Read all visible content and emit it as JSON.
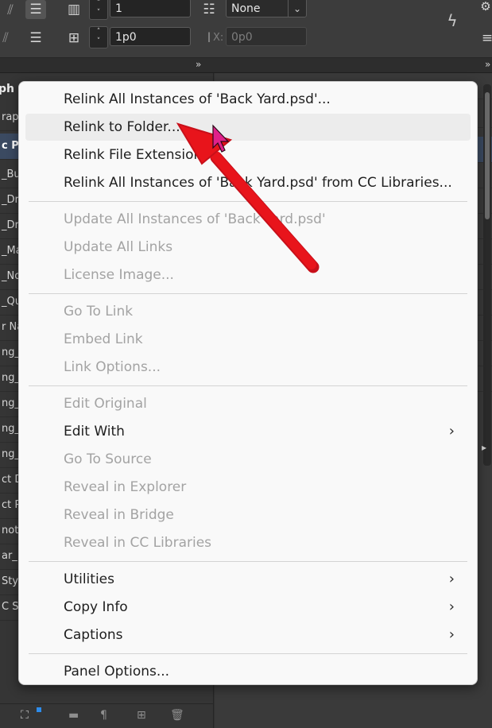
{
  "toolbar": {
    "row1": {
      "columns_value": "1",
      "align_value": "None"
    },
    "row2": {
      "gutter_value": "1p0",
      "indent_label": "X:",
      "indent_value": "0p0"
    }
  },
  "left_panel": {
    "title": "ph S",
    "items": [
      {
        "label": "raph"
      },
      {
        "label": "c P"
      },
      {
        "label": "_Bul"
      },
      {
        "label": "_Dro"
      },
      {
        "label": "_Dro"
      },
      {
        "label": "_Ma"
      },
      {
        "label": "_No"
      },
      {
        "label": "_Que"
      },
      {
        "label": "r Na"
      },
      {
        "label": "ng_"
      },
      {
        "label": "ng_"
      },
      {
        "label": "ng_"
      },
      {
        "label": "ng_"
      },
      {
        "label": "ng_"
      },
      {
        "label": "ct D"
      },
      {
        "label": "ct P"
      },
      {
        "label": "note"
      },
      {
        "label": "ar_E"
      },
      {
        "label": "Sty"
      },
      {
        "label": "C St"
      }
    ]
  },
  "context_menu": {
    "groups": [
      [
        {
          "label": "Relink All Instances of 'Back Yard.psd'...",
          "enabled": true
        },
        {
          "label": "Relink to Folder...",
          "enabled": true
        },
        {
          "label": "Relink File Extension...",
          "enabled": true
        },
        {
          "label": "Relink All Instances of 'Back Yard.psd' from CC Libraries...",
          "enabled": true
        }
      ],
      [
        {
          "label": "Update All Instances of 'Back Yard.psd'",
          "enabled": false
        },
        {
          "label": "Update All Links",
          "enabled": false
        },
        {
          "label": "License Image...",
          "enabled": false
        }
      ],
      [
        {
          "label": "Go To Link",
          "enabled": false
        },
        {
          "label": "Embed Link",
          "enabled": false
        },
        {
          "label": "Link Options...",
          "enabled": false
        }
      ],
      [
        {
          "label": "Edit Original",
          "enabled": false
        },
        {
          "label": "Edit With",
          "enabled": true,
          "submenu": true
        },
        {
          "label": "Go To Source",
          "enabled": false
        },
        {
          "label": "Reveal in Explorer",
          "enabled": false
        },
        {
          "label": "Reveal in Bridge",
          "enabled": false
        },
        {
          "label": "Reveal in CC Libraries",
          "enabled": false
        }
      ],
      [
        {
          "label": "Utilities",
          "enabled": true,
          "submenu": true
        },
        {
          "label": "Copy Info",
          "enabled": true,
          "submenu": true
        },
        {
          "label": "Captions",
          "enabled": true,
          "submenu": true
        }
      ],
      [
        {
          "label": "Panel Options...",
          "enabled": true
        }
      ]
    ],
    "hovered": "Relink to Folder...",
    "submenu_glyph": "›"
  },
  "colors": {
    "annotation_arrow": "#e8141b",
    "cursor": "#e0218a",
    "selection": "#3b4a61"
  }
}
